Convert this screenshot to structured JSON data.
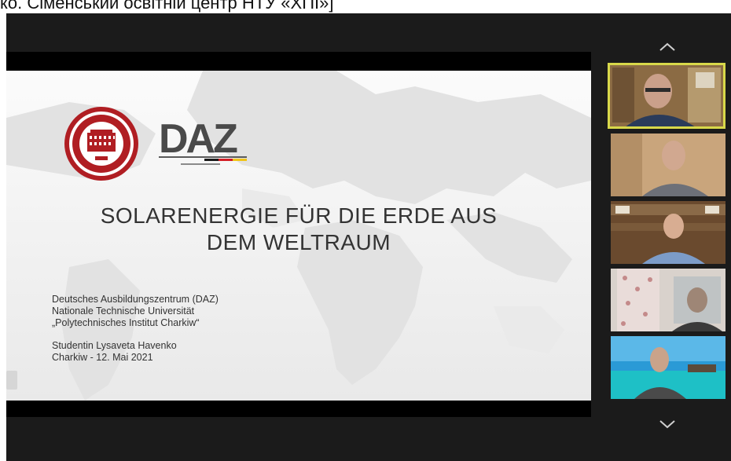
{
  "top_caption": "ко. Сіменський освітній центр НТУ «ХПІ»]",
  "slide": {
    "logo_left_name": "university-seal",
    "logo_right_text": "DAZ",
    "title_line1": "SOLARENERGIE FÜR DIE ERDE AUS",
    "title_line2": "DEM WELTRAUM",
    "info_lines": [
      "Deutsches Ausbildungszentrum (DAZ)",
      "Nationale Technische Universität",
      "„Polytechnisches Institut Charkiw“"
    ],
    "author_lines": [
      "Studentin Lysaveta Havenko",
      "Charkiw - 12. Mai 2021"
    ]
  },
  "participants": [
    {
      "id": "participant-1",
      "active": true
    },
    {
      "id": "participant-2",
      "active": false
    },
    {
      "id": "participant-3",
      "active": false
    },
    {
      "id": "participant-4",
      "active": false
    },
    {
      "id": "participant-5",
      "active": false
    }
  ],
  "icons": {
    "scroll_up": "chevron-up-icon",
    "scroll_down": "chevron-down-icon"
  },
  "colors": {
    "active_speaker_border": "#d8d84a",
    "seal_red": "#b01e23",
    "daz_gray": "#4a4a4a"
  }
}
